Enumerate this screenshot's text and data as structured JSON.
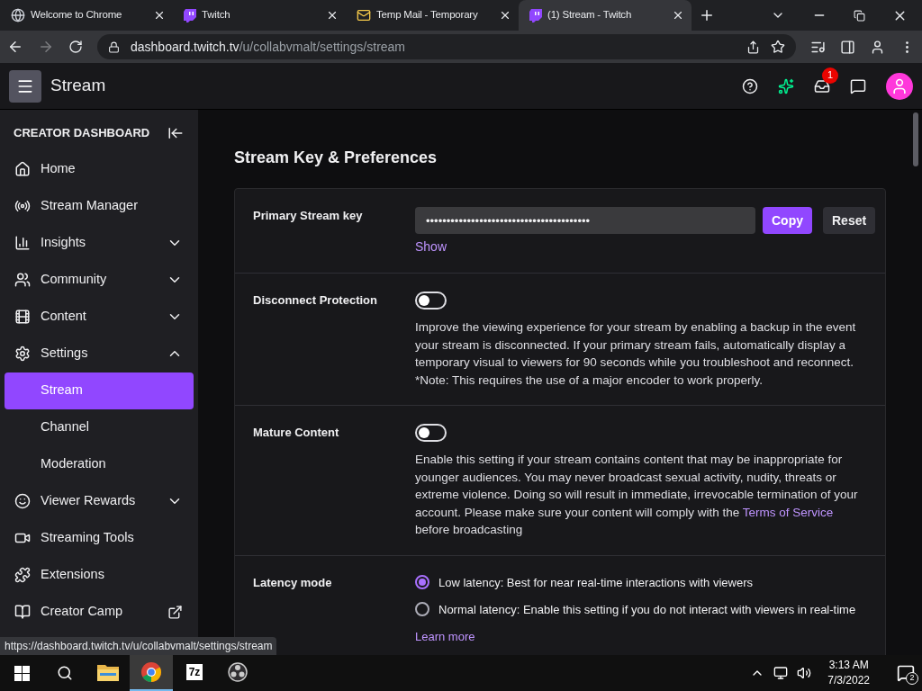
{
  "browser": {
    "tabs": [
      {
        "title": "Welcome to Chrome",
        "selected": false
      },
      {
        "title": "Twitch",
        "selected": false
      },
      {
        "title": "Temp Mail - Temporary",
        "selected": false
      },
      {
        "title": "(1) Stream - Twitch",
        "selected": true
      }
    ],
    "url_host": "dashboard.twitch.tv",
    "url_path": "/u/collabvmalt/settings/stream"
  },
  "topnav": {
    "title": "Stream",
    "inbox_badge": "1"
  },
  "sidebar": {
    "heading": "CREATOR DASHBOARD",
    "items": [
      {
        "label": "Home"
      },
      {
        "label": "Stream Manager"
      },
      {
        "label": "Insights",
        "expanded": false
      },
      {
        "label": "Community",
        "expanded": false
      },
      {
        "label": "Content",
        "expanded": false
      },
      {
        "label": "Settings",
        "expanded": true,
        "children": [
          {
            "label": "Stream",
            "selected": true
          },
          {
            "label": "Channel",
            "selected": false
          },
          {
            "label": "Moderation",
            "selected": false
          }
        ]
      },
      {
        "label": "Viewer Rewards",
        "expanded": false
      },
      {
        "label": "Streaming Tools"
      },
      {
        "label": "Extensions"
      },
      {
        "label": "Creator Camp",
        "external": true
      }
    ]
  },
  "page": {
    "title": "Stream Key & Preferences",
    "sections": [
      {
        "kind": "key",
        "label": "Primary Stream key",
        "value": "••••••••••••••••••••••••••••••••••••••••",
        "copy": "Copy",
        "reset": "Reset",
        "show": "Show"
      },
      {
        "kind": "toggle",
        "label": "Disconnect Protection",
        "on": false,
        "description": "Improve the viewing experience for your stream by enabling a backup in the event your stream is disconnected. If your primary stream fails, automatically display a temporary visual to viewers for 90 seconds while you troubleshoot and reconnect. *Note: This requires the use of a major encoder to work properly."
      },
      {
        "kind": "toggle",
        "label": "Mature Content",
        "on": false,
        "description": "Enable this setting if your stream contains content that may be inappropriate for younger audiences. You may never broadcast sexual activity, nudity, threats or extreme violence. Doing so will result in immediate, irrevocable termination of your account. Please make sure your content will comply with the",
        "link": "Terms of Service",
        "after": "before broadcasting"
      },
      {
        "kind": "radio",
        "label": "Latency mode",
        "options": [
          {
            "label": "Low latency: Best for near real-time interactions with viewers",
            "selected": true
          },
          {
            "label": "Normal latency: Enable this setting if you do not interact with viewers in real-time",
            "selected": false
          }
        ],
        "link": "Learn more"
      }
    ]
  },
  "status_url": "https://dashboard.twitch.tv/u/collabvmalt/settings/stream",
  "taskbar": {
    "apps": [
      {
        "kind": "folder",
        "active": false
      },
      {
        "kind": "chrome",
        "active": true
      },
      {
        "kind": "archiver",
        "label": "7z",
        "active": false
      },
      {
        "kind": "obs",
        "active": false
      }
    ],
    "time": "3:13 AM",
    "date": "7/3/2022",
    "notifications": "2"
  }
}
